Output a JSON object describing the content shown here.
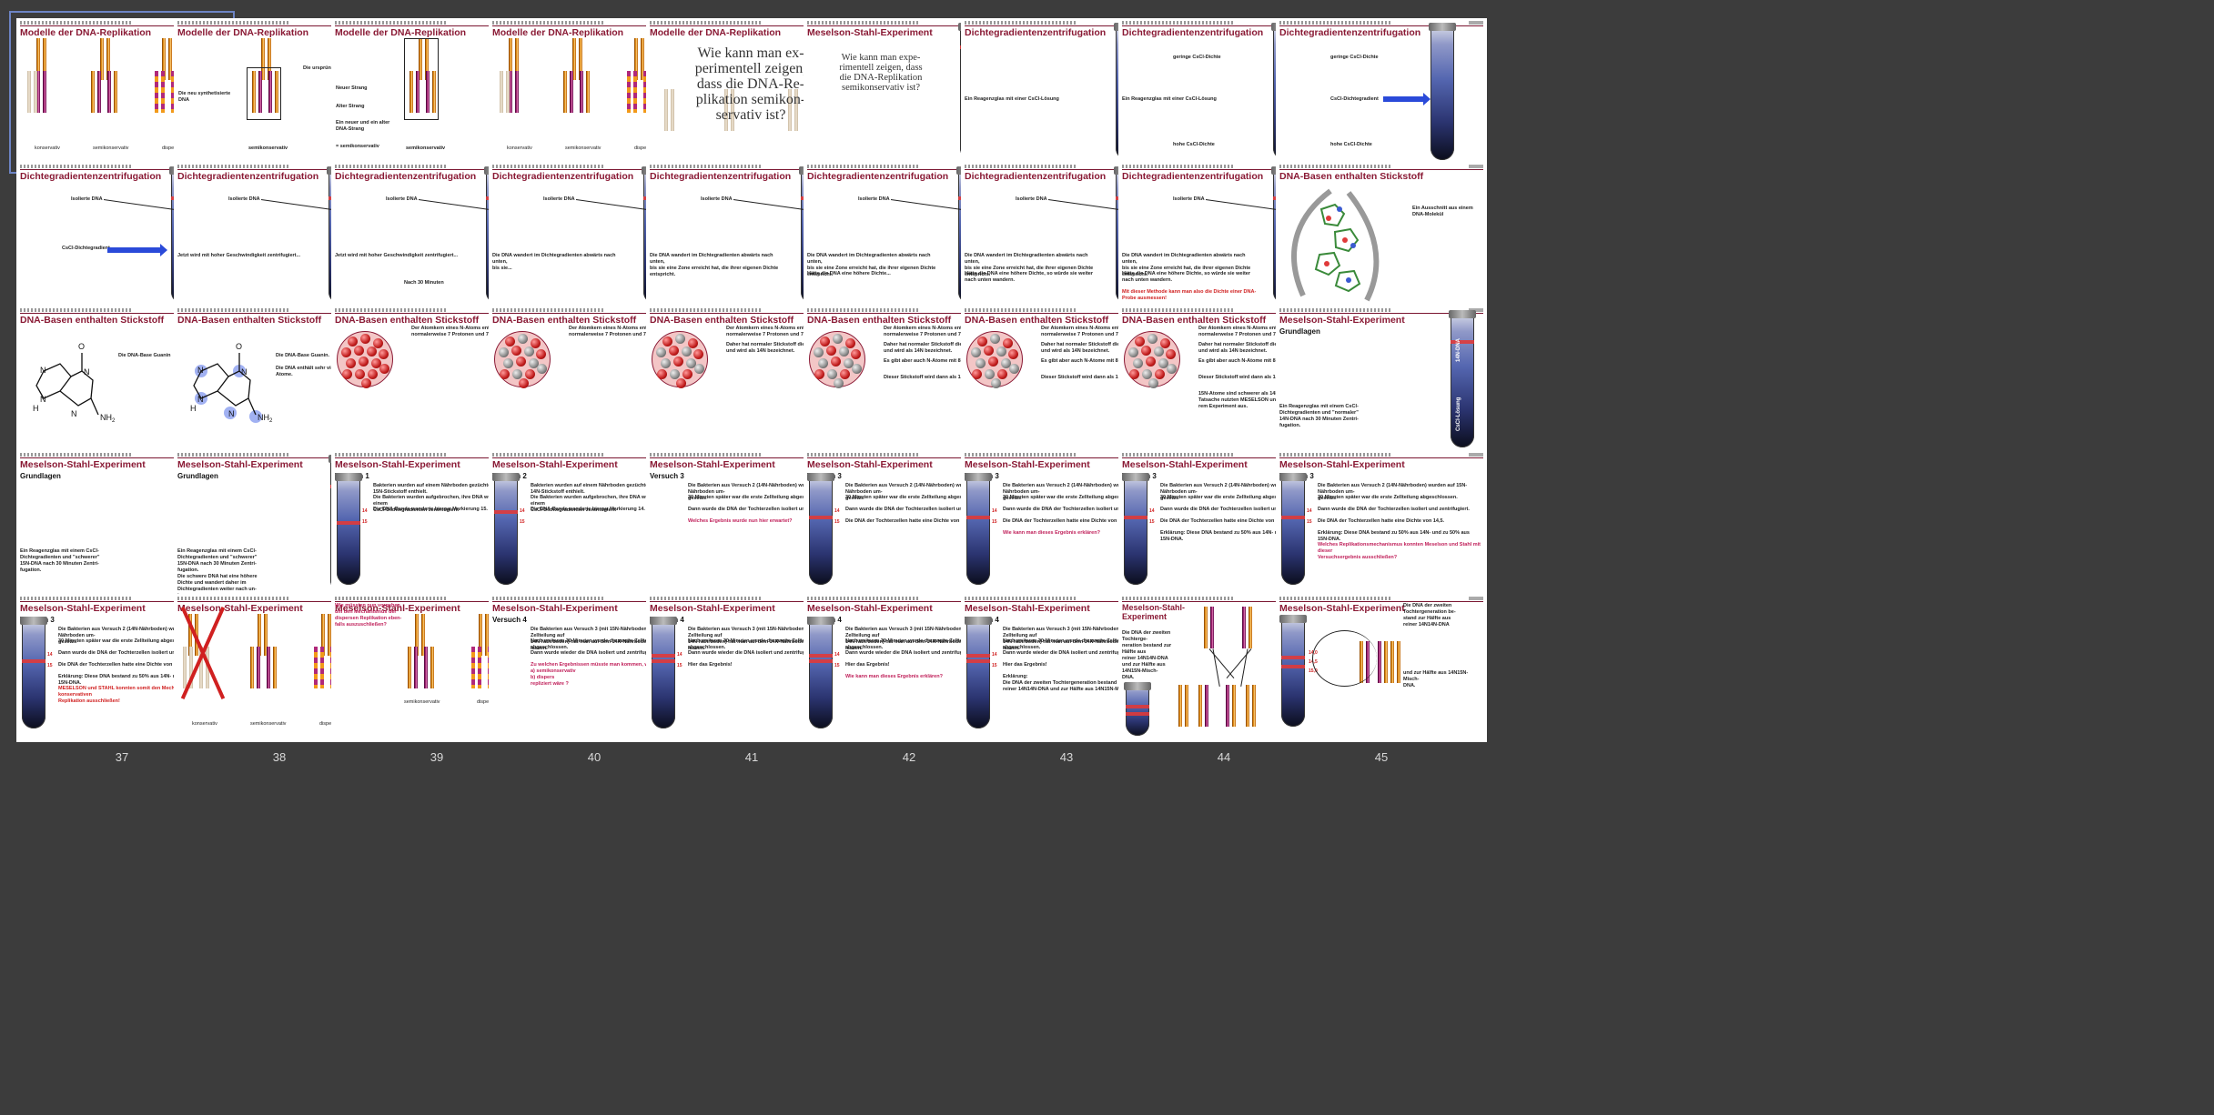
{
  "slides": [
    {
      "n": "1",
      "title": "Modelle der DNA-Replikation",
      "labels": [
        "konservativ",
        "semikonservativ",
        "dispers"
      ]
    },
    {
      "n": "2",
      "title": "Modelle der DNA-Replikation",
      "labels": [
        "Die neu synthetisierte DNA",
        "Die ursprüngliche DNA",
        "semikonservativ"
      ]
    },
    {
      "n": "3",
      "title": "Modelle der DNA-Replikation",
      "labels": [
        "Neuer Strang",
        "Alter Strang",
        "Ein neuer und ein alter DNA-Strang",
        "= semikonservativ",
        "semikonservativ"
      ]
    },
    {
      "n": "4",
      "title": "Modelle der DNA-Replikation",
      "labels": [
        "konservativ",
        "semikonservativ",
        "dispers"
      ]
    },
    {
      "n": "5",
      "title": "Modelle der DNA-Replikation",
      "question": "Wie kann man ex-\nperimentell zeigen,\ndass die DNA-Re-\nplikation semikon-\nservativ ist?"
    },
    {
      "n": "6",
      "title": "Meselson-Stahl-Experiment",
      "question": "Wie kann man expe-\nrimentell zeigen, dass\ndie DNA-Replikation\nsemikonservativ ist?"
    },
    {
      "n": "7",
      "title": "Dichtegradientenzentrifugation",
      "labels": [
        "Ein Reagenzglas mit einer CsCl-Lösung"
      ]
    },
    {
      "n": "8",
      "title": "Dichtegradientenzentrifugation",
      "labels": [
        "geringe CsCl-Dichte",
        "Ein Reagenzglas mit einer CsCl-Lösung",
        "hohe CsCl-Dichte"
      ]
    },
    {
      "n": "9",
      "title": "Dichtegradientenzentrifugation",
      "labels": [
        "geringe CsCl-Dichte",
        "CsCl-Dichtegradient",
        "hohe CsCl-Dichte"
      ]
    },
    {
      "n": "10",
      "title": "Dichtegradientenzentrifugation",
      "labels": [
        "Isolierte DNA",
        "CsCl-Dichtegradient"
      ]
    },
    {
      "n": "11",
      "title": "Dichtegradientenzentrifugation",
      "labels": [
        "Isolierte DNA",
        "Jetzt wird mit hoher Geschwindigkeit zentrifugiert..."
      ]
    },
    {
      "n": "12",
      "title": "Dichtegradientenzentrifugation",
      "labels": [
        "Isolierte DNA",
        "Jetzt wird mit hoher Geschwindigkeit zentrifugiert...",
        "Nach 30 Minuten"
      ]
    },
    {
      "n": "13",
      "title": "Dichtegradientenzentrifugation",
      "labels": [
        "Isolierte DNA",
        "Die DNA wandert im Dichtegradienten abwärts nach unten,\nbis sie..."
      ]
    },
    {
      "n": "14",
      "title": "Dichtegradientenzentrifugation",
      "labels": [
        "Isolierte DNA",
        "Die DNA wandert im Dichtegradienten abwärts nach unten,\nbis sie eine Zone erreicht hat, die ihrer eigenen Dichte\nentspricht."
      ]
    },
    {
      "n": "15",
      "title": "Dichtegradientenzentrifugation",
      "labels": [
        "Isolierte DNA",
        "Die DNA wandert im Dichtegradienten abwärts nach unten,\nbis sie eine Zone erreicht hat, die ihrer eigenen Dichte\nentspricht.",
        "Hätte die DNA eine höhere Dichte..."
      ]
    },
    {
      "n": "16",
      "title": "Dichtegradientenzentrifugation",
      "labels": [
        "Isolierte DNA",
        "Die DNA wandert im Dichtegradienten abwärts nach unten,\nbis sie eine Zone erreicht hat, die ihrer eigenen Dichte\nentspricht.",
        "Hätte die DNA eine höhere Dichte, so würde sie weiter\nnach unten wandern."
      ]
    },
    {
      "n": "17",
      "title": "Dichtegradientenzentrifugation",
      "labels": [
        "Isolierte DNA",
        "Die DNA wandert im Dichtegradienten abwärts nach unten,\nbis sie eine Zone erreicht hat, die ihrer eigenen Dichte\nentspricht.",
        "Hätte die DNA eine höhere Dichte, so würde sie weiter\nnach unten wandern.",
        "Mit dieser Methode kann man also die Dichte einer DNA-\nProbe ausmessen!"
      ]
    },
    {
      "n": "18",
      "title": "DNA-Basen enthalten Stickstoff",
      "labels": [
        "Ein Ausschnitt aus einem DNA-Molekül"
      ]
    },
    {
      "n": "19",
      "title": "DNA-Basen enthalten Stickstoff",
      "labels": [
        "Die DNA-Base Guanin"
      ]
    },
    {
      "n": "20",
      "title": "DNA-Basen enthalten Stickstoff",
      "labels": [
        "Die DNA-Base Guanin.",
        "Die DNA enthält sehr viele Stickstoff-Atome."
      ]
    },
    {
      "n": "21",
      "title": "DNA-Basen enthalten Stickstoff",
      "labels": [
        "Der Atomkern eines N-Atoms enthält\nnormalerweise 7 Protonen und 7 Neutronen."
      ]
    },
    {
      "n": "22",
      "title": "DNA-Basen enthalten Stickstoff",
      "labels": [
        "Der Atomkern eines N-Atoms enthält\nnormalerweise 7 Protonen und 7 Neutronen."
      ]
    },
    {
      "n": "23",
      "title": "DNA-Basen enthalten Stickstoff",
      "labels": [
        "Der Atomkern eines N-Atoms enthält\nnormalerweise 7 Protonen und 7 Neutronen.",
        "Daher hat normaler Stickstoff die Atommasse 14\nund wird als 14N bezeichnet."
      ]
    },
    {
      "n": "24",
      "title": "DNA-Basen enthalten Stickstoff",
      "labels": [
        "Der Atomkern eines N-Atoms enthält\nnormalerweise 7 Protonen und 7 Neutronen.",
        "Daher hat normaler Stickstoff die Atommasse 14\nund wird als 14N bezeichnet.",
        "Es gibt aber auch N-Atome mit 8 Neutronen.",
        "Dieser Stickstoff wird dann als 15N bezeichnet."
      ]
    },
    {
      "n": "25",
      "title": "DNA-Basen enthalten Stickstoff",
      "labels": [
        "Der Atomkern eines N-Atoms enthält\nnormalerweise 7 Protonen und 7 Neutronen.",
        "Daher hat normaler Stickstoff die Atommasse 14\nund wird als 14N bezeichnet.",
        "Es gibt aber auch N-Atome mit 8 Neutronen.",
        "Dieser Stickstoff wird dann als 15N bezeichnet."
      ]
    },
    {
      "n": "26",
      "title": "DNA-Basen enthalten Stickstoff",
      "labels": [
        "Der Atomkern eines N-Atoms enthält\nnormalerweise 7 Protonen und 7 Neutronen.",
        "Daher hat normaler Stickstoff die Atommasse 14\nund wird als 14N bezeichnet.",
        "Es gibt aber auch N-Atome mit 8 Neutronen.",
        "Dieser Stickstoff wird dann als 15N bezeichnet.",
        "15N-Atome sind schwerer als 14N-Atome, und diese\nTatsache nutzten MESELSON und STAHL bei ih-\nrem Experiment aus."
      ]
    },
    {
      "n": "27",
      "title": "Meselson-Stahl-Experiment",
      "subtitle": "Grundlagen",
      "labels": [
        "Ein Reagenzglas mit einem CsCl-\nDichtegradienten und \"normaler\"\n14N-DNA nach 30 Minuten Zentri-\nfugation."
      ],
      "tube_labels": [
        "14N-DNA",
        "CsCl-Lösung"
      ]
    },
    {
      "n": "28",
      "title": "Meselson-Stahl-Experiment",
      "subtitle": "Grundlagen",
      "labels": [
        "Ein Reagenzglas mit einem CsCl-\nDichtegradienten und \"schwerer\"\n15N-DNA nach 30 Minuten Zentri-\nfugation."
      ],
      "tube_labels": [
        "15N-DNA",
        "CsCl-Lösung"
      ]
    },
    {
      "n": "29",
      "title": "Meselson-Stahl-Experiment",
      "subtitle": "Grundlagen",
      "labels": [
        "Ein Reagenzglas mit einem CsCl-\nDichtegradienten und \"schwerer\"\n15N-DNA nach 30 Minuten Zentri-\nfugation.",
        "Die schwere DNA hat eine höhere\nDichte und wandert daher im\nDichtegradienten weiter nach un-\nten."
      ],
      "tube_labels": [
        "14N-DNA",
        "CsCl-Lösung",
        "15N-DNA",
        "CsCl-Lösung"
      ]
    },
    {
      "n": "30",
      "title": "Meselson-Stahl-Experiment",
      "subtitle": "Versuch 1",
      "labels": [
        "Bakterien wurden auf einem Nährboden gezüchtet, der schweren\n15N-Stickstoff enthielt.",
        "Die Bakterien wurden aufgebrochen, ihre DNA wurde isoliert und auf einem\nCsCl-Dichtegradienten zentrifugiert.",
        "Die DNA-Bande wanderte bis zur Markierung 15."
      ],
      "marks": [
        "14",
        "15"
      ]
    },
    {
      "n": "31",
      "title": "Meselson-Stahl-Experiment",
      "subtitle": "Versuch 2",
      "labels": [
        "Bakterien wurden auf einem Nährboden gezüchtet, der normalen\n14N-Stickstoff enthielt.",
        "Die Bakterien wurden aufgebrochen, ihre DNA wurde isoliert und auf einem\nCsCl-Dichtegradienten zentrifugiert.",
        "Die DNA-Bande wanderte bis zur Markierung 14."
      ],
      "marks": [
        "14",
        "15"
      ]
    },
    {
      "n": "32",
      "title": "Meselson-Stahl-Experiment",
      "subtitle": "Versuch 3",
      "labels": [
        "Die Bakterien aus Versuch 2 (14N-Nährboden) wurden auf 15N-Nährboden um-\ngesetzt.",
        "30 Minuten später war die erste Zellteilung abgeschlossen.",
        "Dann wurde die DNA der Tochterzellen isoliert und zentrifugiert.",
        "Welches Ergebnis wurde nun hier erwartet?"
      ]
    },
    {
      "n": "33",
      "title": "Meselson-Stahl-Experiment",
      "subtitle": "Versuch 3",
      "labels": [
        "Die Bakterien aus Versuch 2 (14N-Nährboden) wurden auf 15N-Nährboden um-\ngesetzt.",
        "30 Minuten später war die erste Zellteilung abgeschlossen.",
        "Dann wurde die DNA der Tochterzellen isoliert und zentrifugiert.",
        "Die DNA der Tochterzellen hatte eine Dichte von 14,5."
      ],
      "marks": [
        "14",
        "15"
      ]
    },
    {
      "n": "34",
      "title": "Meselson-Stahl-Experiment",
      "subtitle": "Versuch 3",
      "labels": [
        "Die Bakterien aus Versuch 2 (14N-Nährboden) wurden auf 15N-Nährboden um-\ngesetzt.",
        "30 Minuten später war die erste Zellteilung abgeschlossen.",
        "Dann wurde die DNA der Tochterzellen isoliert und zentrifugiert.",
        "Die DNA der Tochterzellen hatte eine Dichte von 14,5.",
        "Wie kann man dieses Ergebnis erklären?"
      ],
      "marks": [
        "14",
        "15"
      ]
    },
    {
      "n": "35",
      "title": "Meselson-Stahl-Experiment",
      "subtitle": "Versuch 3",
      "labels": [
        "Die Bakterien aus Versuch 2 (14N-Nährboden) wurden auf 15N-Nährboden um-\ngesetzt.",
        "30 Minuten später war die erste Zellteilung abgeschlossen.",
        "Dann wurde die DNA der Tochterzellen isoliert und zentrifugiert.",
        "Die DNA der Tochterzellen hatte eine Dichte von 14,5.",
        "Erklärung: Diese DNA bestand zu 50% aus 14N- und zu 50% aus 15N-DNA."
      ],
      "marks": [
        "14",
        "15"
      ]
    },
    {
      "n": "36",
      "title": "Meselson-Stahl-Experiment",
      "subtitle": "Versuch 3",
      "labels": [
        "Die Bakterien aus Versuch 2 (14N-Nährboden) wurden auf 15N-Nährboden um-\ngesetzt.",
        "30 Minuten später war die erste Zellteilung abgeschlossen.",
        "Dann wurde die DNA der Tochterzellen isoliert und zentrifugiert.",
        "Die DNA der Tochterzellen hatte eine Dichte von 14,5.",
        "Erklärung: Diese DNA bestand zu 50% aus 14N- und zu 50% aus 15N-DNA.",
        "Welches Replikationsmechanismus konnten Meselson und Stahl mit dieser\nVersuchsergebnis ausschließen?"
      ],
      "marks": [
        "14",
        "15"
      ]
    },
    {
      "n": "37",
      "title": "Meselson-Stahl-Experiment",
      "subtitle": "Versuch 3",
      "labels": [
        "Die Bakterien aus Versuch 2 (14N-Nährboden) wurden auf 15N-Nährboden um-\ngesetzt.",
        "30 Minuten später war die erste Zellteilung abgeschlossen.",
        "Dann wurde die DNA der Tochterzellen isoliert und zentrifugiert.",
        "Die DNA der Tochterzellen hatte eine Dichte von 14,5.",
        "Erklärung: Diese DNA bestand zu 50% aus 14N- und zu 50% aus 15N-DNA.",
        "MESELSON und STAHL konnten somit den Mechanismus der konservativen\nReplikation ausschließen!"
      ],
      "marks": [
        "14",
        "15"
      ]
    },
    {
      "n": "38",
      "title": "Meselson-Stahl-Experiment",
      "labels": [
        "konservativ",
        "semikonservativ",
        "dispers"
      ]
    },
    {
      "n": "39",
      "title": "Meselson-Stahl-Experiment",
      "labels": [
        "Wie müssten nun vorgehen,\num den Mechanismus der\ndispersen Replikation eben-\nfalls auszuschließen?",
        "semikonservativ",
        "dispers"
      ]
    },
    {
      "n": "40",
      "title": "Meselson-Stahl-Experiment",
      "subtitle": "Versuch 4",
      "labels": [
        "Die Bakterien aus Versuch 3 (mit 15N-Nährboden), dann eine Zellteilung auf\n14N-Nährboden) hat man auf dem 14N-Nährboden weiter wachsen lassen.",
        "Nach weiteren 30 Minuten wurde die zweite Zellteilung abgeschlossen.",
        "Dann wurde wieder die DNA isoliert und zentrifugiert.",
        "Zu welchen Ergebnissen müsste man kommen, wenn die DNA\na) semikonservativ\nb) dispers\nrepliziert wäre ?"
      ]
    },
    {
      "n": "41",
      "title": "Meselson-Stahl-Experiment",
      "subtitle": "Versuch 4",
      "labels": [
        "Die Bakterien aus Versuch 3 (mit 15N-Nährboden), dann eine Zellteilung auf\n14N-Nährboden) hat man auf dem 14N-Nährboden weiter wachsen lassen.",
        "Nach weiteren 30 Minuten wurde die zweite Zellteilung abgeschlossen.",
        "Dann wurde wieder die DNA isoliert und zentrifugiert.",
        "Hier das Ergebnis!"
      ],
      "marks": [
        "14",
        "15"
      ]
    },
    {
      "n": "42",
      "title": "Meselson-Stahl-Experiment",
      "subtitle": "Versuch 4",
      "labels": [
        "Die Bakterien aus Versuch 3 (mit 15N-Nährboden), dann eine Zellteilung auf\n14N-Nährboden) hat man auf dem 14N-Nährboden weiter wachsen lassen.",
        "Nach weiteren 30 Minuten wurde die zweite Zellteilung abgeschlossen.",
        "Dann wurde wieder die DNA isoliert und zentrifugiert.",
        "Hier das Ergebnis!",
        "Wie kann man dieses Ergebnis erklären?"
      ],
      "marks": [
        "14",
        "15"
      ]
    },
    {
      "n": "43",
      "title": "Meselson-Stahl-Experiment",
      "subtitle": "Versuch 4",
      "labels": [
        "Die Bakterien aus Versuch 3 (mit 15N-Nährboden), dann eine Zellteilung auf\n14N-Nährboden) hat man auf dem 14N-Nährboden weiter wachsen lassen.",
        "Nach weiteren 30 Minuten wurde die zweite Zellteilung abgeschlossen.",
        "Dann wurde wieder die DNA isoliert und zentrifugiert.",
        "Hier das Ergebnis!",
        "Erklärung:\nDie DNA der zweiten Tochtergeneration bestand zur Hälfte aus\nreiner 14N14N-DNA und zur Hälfte aus 14N15N-Misch-DNA."
      ],
      "marks": [
        "14",
        "15"
      ]
    },
    {
      "n": "44",
      "title": "Meselson-Stahl-\nExperiment",
      "labels": [
        "Die DNA der zweiten Tochterge-\nneration bestand zur Hälfte aus\nreiner 14N14N-DNA\nund zur Hälfte aus 14N15N-Misch-\nDNA."
      ]
    },
    {
      "n": "45",
      "title": "Meselson-Stahl-Experiment",
      "labels": [
        "Die DNA der zweiten\nTochtergeneration be-\nstand zur Hälfte aus\nreiner 14N14N-DNA",
        "und zur Hälfte aus 14N15N-Misch-\nDNA."
      ],
      "marks": [
        "14,0",
        "14,5",
        "15,0"
      ]
    }
  ],
  "selected_slide": "1",
  "colors": {
    "title": "#8a1a35",
    "background": "#3c3c3c",
    "selection": "#6d84c4",
    "band": "#e03a3a",
    "arrow": "#2a4ad9"
  }
}
